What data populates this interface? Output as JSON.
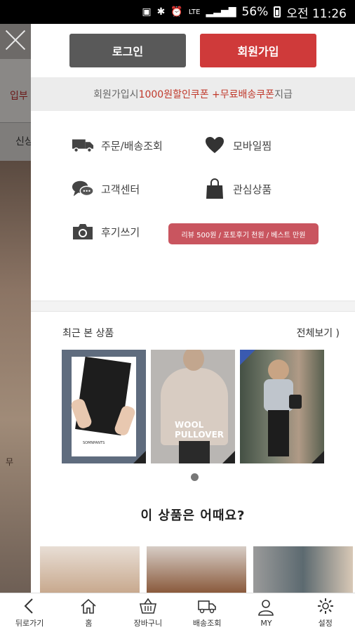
{
  "status": {
    "battery": "56%",
    "time": "오전 11:26",
    "network": "LTE"
  },
  "background_page": {
    "text1": "입부",
    "text2": "신상",
    "text3": "무"
  },
  "auth": {
    "login_label": "로그인",
    "join_label": "회원가입"
  },
  "promo": {
    "prefix": "회원가입시 ",
    "highlight": "1000원할인쿠폰 +무료배송쿠폰",
    "suffix": " 지급"
  },
  "menu": {
    "order": {
      "label": "주문/배송조회",
      "icon": "truck-icon"
    },
    "wishlist": {
      "label": "모바일찜",
      "icon": "heart-icon"
    },
    "support": {
      "label": "고객센터",
      "icon": "chat-bubbles-icon"
    },
    "interest": {
      "label": "관심상품",
      "icon": "shopping-bag-icon"
    },
    "review": {
      "label": "후기쓰기",
      "icon": "camera-icon"
    },
    "review_badge": "리뷰 500원 / 포토후기 천원 / 베스트 만원"
  },
  "recent": {
    "title": "최근 본 상품",
    "view_all": "전체보기 )",
    "item2_text_line1": "WOOL",
    "item2_text_line2": "PULLOVER",
    "item1_caption": "SOMNPANTS"
  },
  "suggest": {
    "title": "이 상품은 어때요?"
  },
  "bottom_nav": {
    "back": "뒤로가기",
    "home": "홈",
    "cart": "장바구니",
    "delivery": "배송조회",
    "my": "MY",
    "settings": "설정"
  },
  "colors": {
    "accent_red": "#cf3a3a",
    "dark_button": "#595959",
    "badge": "#c9555f"
  }
}
